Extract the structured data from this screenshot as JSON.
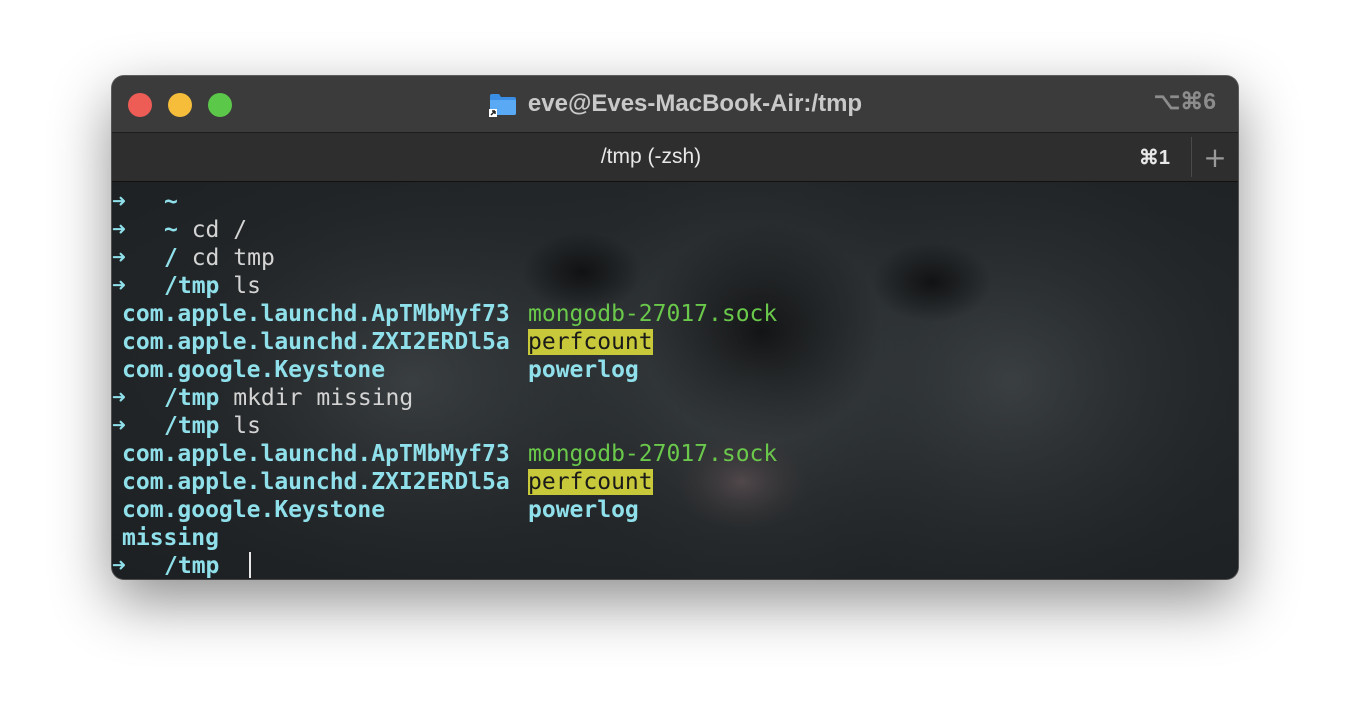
{
  "window": {
    "title": "eve@Eves-MacBook-Air:/tmp",
    "shortcut": "⌥⌘6",
    "folder_icon": "folder-icon"
  },
  "tab": {
    "title": "/tmp (-zsh)",
    "shortcut": "⌘1",
    "add_label": "+"
  },
  "prompt_arrow": "➜",
  "lines": [
    {
      "kind": "prompt",
      "path": "~",
      "cmd": ""
    },
    {
      "kind": "prompt",
      "path": "~",
      "cmd": "cd /"
    },
    {
      "kind": "prompt",
      "path": "/",
      "cmd": "cd tmp"
    },
    {
      "kind": "prompt",
      "path": "/tmp",
      "cmd": "ls"
    },
    {
      "kind": "output",
      "col1": "com.apple.launchd.ApTMbMyf73",
      "col2": "mongodb-27017.sock",
      "col2_style": "green"
    },
    {
      "kind": "output",
      "col1": "com.apple.launchd.ZXI2ERDl5a",
      "col2": "perfcount",
      "col2_style": "highlight"
    },
    {
      "kind": "output",
      "col1": "com.google.Keystone",
      "col2": "powerlog",
      "col2_style": "bold"
    },
    {
      "kind": "prompt",
      "path": "/tmp",
      "cmd": "mkdir missing"
    },
    {
      "kind": "prompt",
      "path": "/tmp",
      "cmd": "ls"
    },
    {
      "kind": "output",
      "col1": "com.apple.launchd.ApTMbMyf73",
      "col2": "mongodb-27017.sock",
      "col2_style": "green"
    },
    {
      "kind": "output",
      "col1": "com.apple.launchd.ZXI2ERDl5a",
      "col2": "perfcount",
      "col2_style": "highlight"
    },
    {
      "kind": "output",
      "col1": "com.google.Keystone",
      "col2": "powerlog",
      "col2_style": "bold"
    },
    {
      "kind": "output",
      "col1": "missing",
      "col2": "",
      "col2_style": "none"
    },
    {
      "kind": "prompt",
      "path": "/tmp",
      "cmd": "",
      "cursor": true
    }
  ],
  "colors": {
    "prompt": "#8fe0ea",
    "socket": "#6ac84b",
    "highlight_bg": "#c7c83a",
    "close": "#ee5c56",
    "minimize": "#f5bd3a",
    "maximize": "#5bc84a"
  }
}
